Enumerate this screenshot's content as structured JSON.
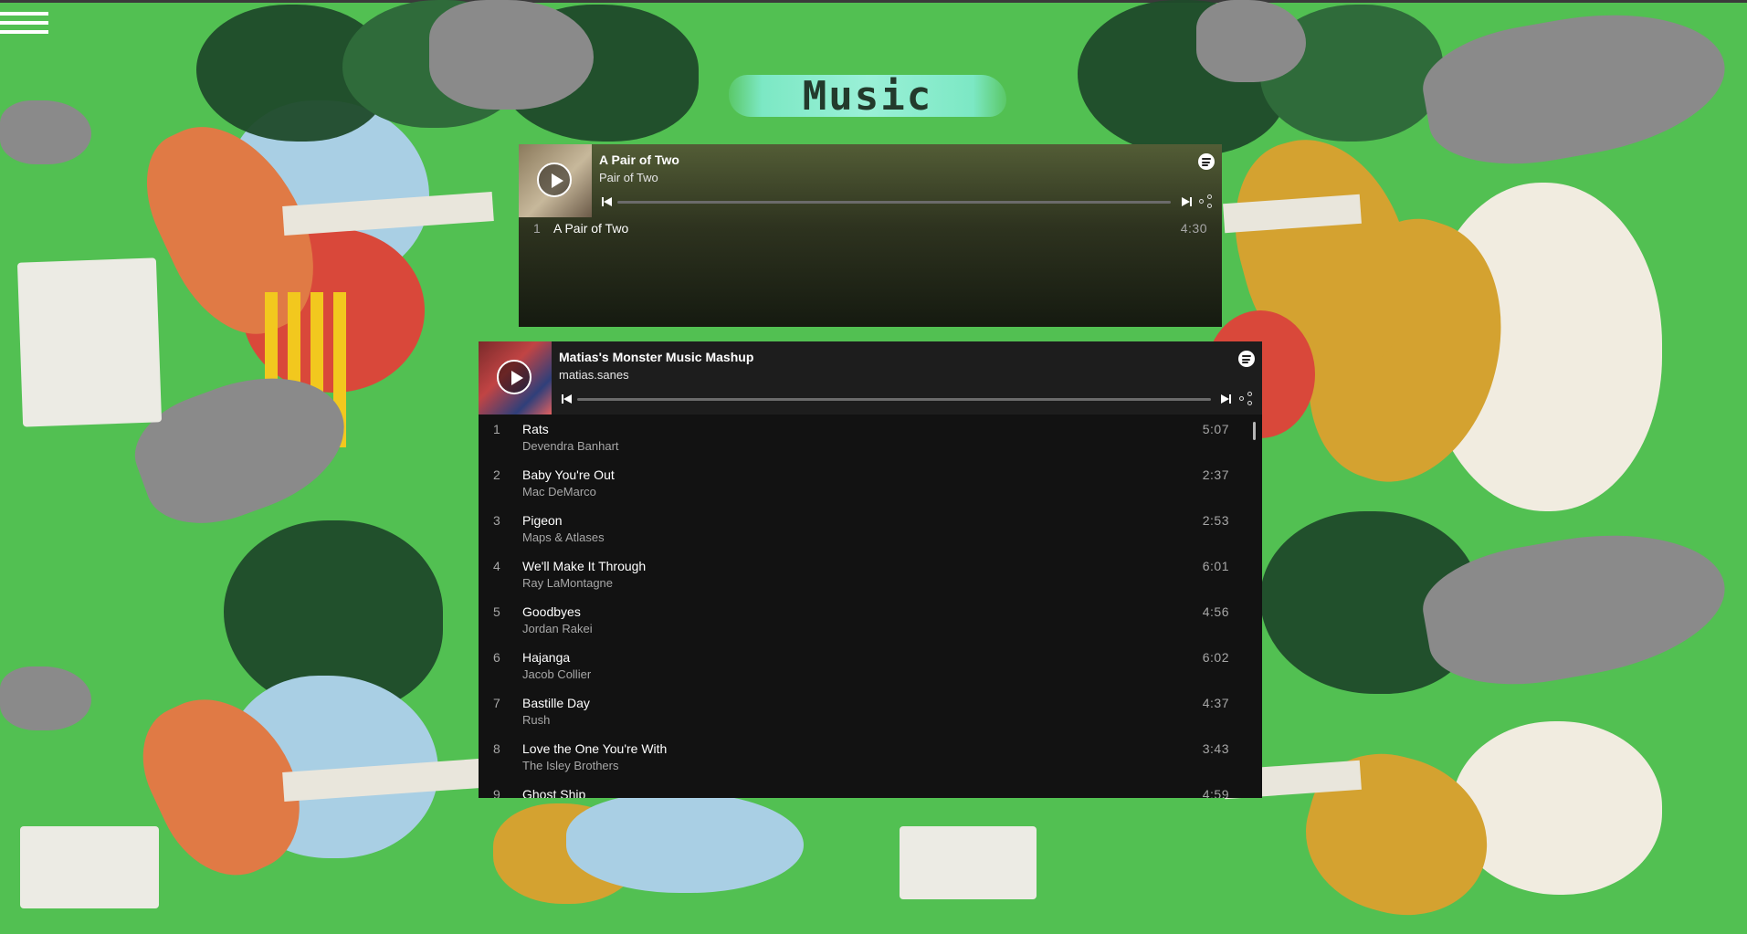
{
  "page": {
    "title": "Music"
  },
  "colors": {
    "background": "#52c052",
    "embed_dark": "#121212",
    "muted_text": "#a7a7a7"
  },
  "icons": [
    "menu-icon",
    "play-icon",
    "spotify-icon",
    "skip-back-icon",
    "skip-forward-icon",
    "share-icon"
  ],
  "embed1": {
    "title": "A Pair of Two",
    "subtitle": "Pair of Two",
    "tracks": [
      {
        "num": "1",
        "name": "A Pair of Two",
        "duration": "4:30"
      }
    ]
  },
  "embed2": {
    "title": "Matias's Monster Music Mashup",
    "subtitle": "matias.sanes",
    "tracks": [
      {
        "num": "1",
        "name": "Rats",
        "artist": "Devendra Banhart",
        "duration": "5:07"
      },
      {
        "num": "2",
        "name": "Baby You're Out",
        "artist": "Mac DeMarco",
        "duration": "2:37"
      },
      {
        "num": "3",
        "name": "Pigeon",
        "artist": "Maps & Atlases",
        "duration": "2:53"
      },
      {
        "num": "4",
        "name": "We'll Make It Through",
        "artist": "Ray LaMontagne",
        "duration": "6:01"
      },
      {
        "num": "5",
        "name": "Goodbyes",
        "artist": "Jordan Rakei",
        "duration": "4:56"
      },
      {
        "num": "6",
        "name": "Hajanga",
        "artist": "Jacob Collier",
        "duration": "6:02"
      },
      {
        "num": "7",
        "name": "Bastille Day",
        "artist": "Rush",
        "duration": "4:37"
      },
      {
        "num": "8",
        "name": "Love the One You're With",
        "artist": "The Isley Brothers",
        "duration": "3:43"
      },
      {
        "num": "9",
        "name": "Ghost Ship",
        "artist": "",
        "duration": "4:59"
      }
    ]
  }
}
